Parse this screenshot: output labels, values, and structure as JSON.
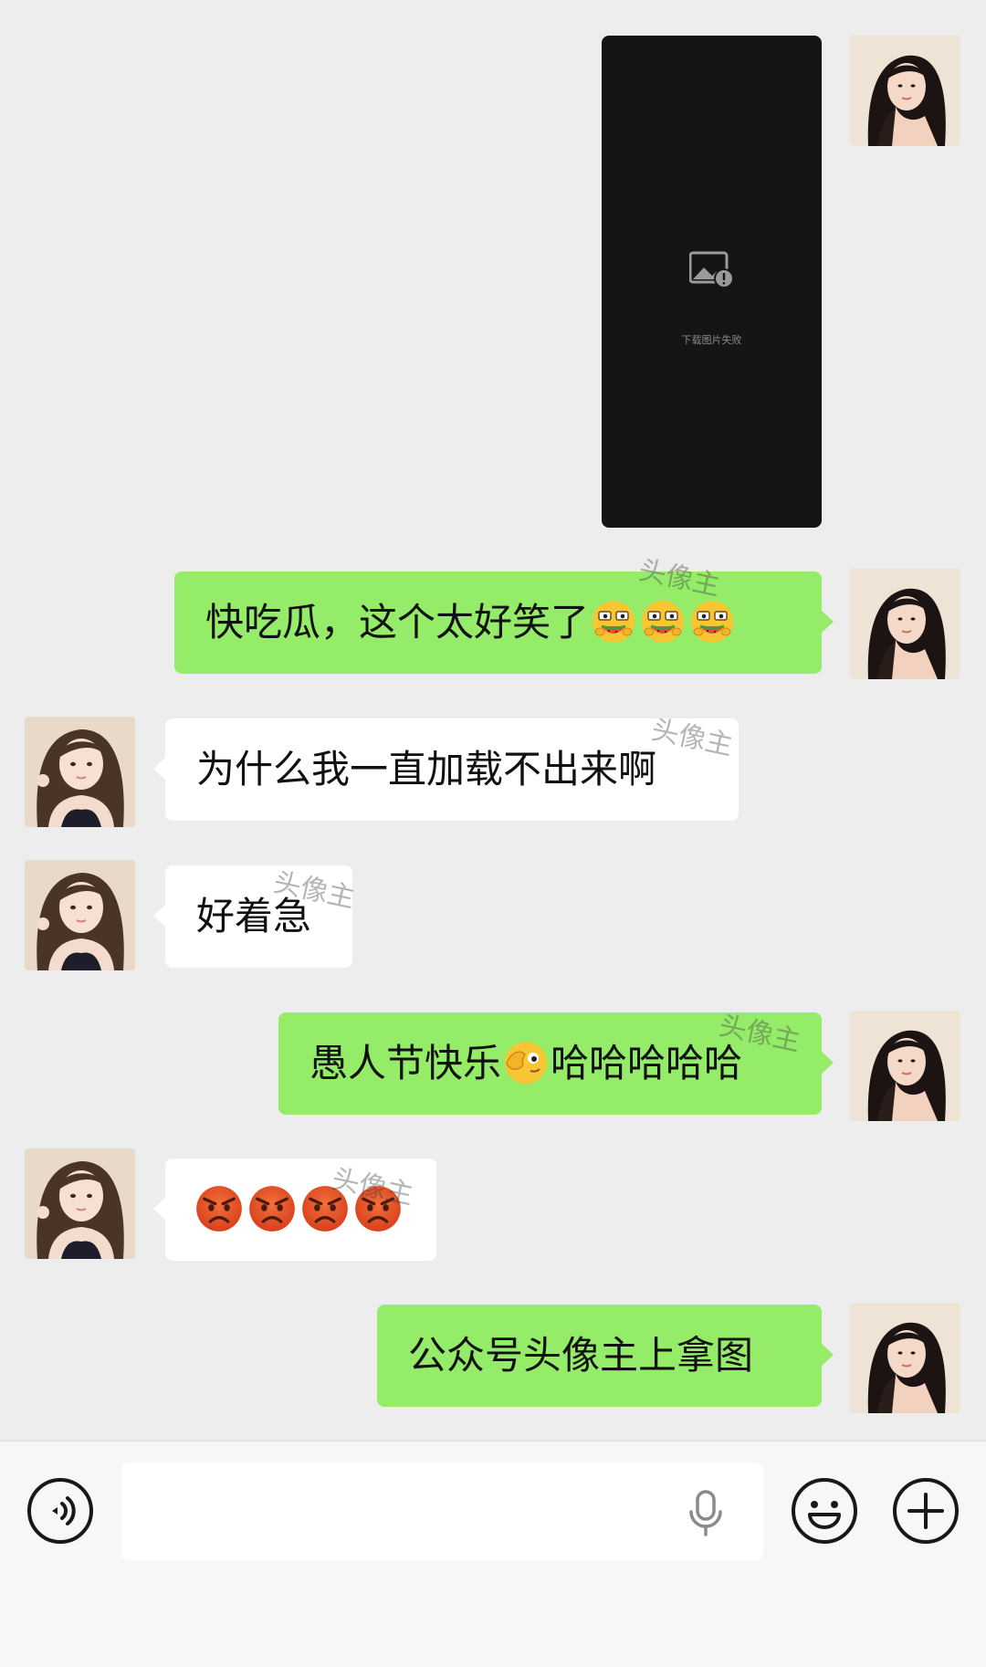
{
  "image_message": {
    "status_text": "下载图片失败",
    "icon": "image-broken-icon"
  },
  "messages": [
    {
      "side": "me",
      "text": "快吃瓜，这个太好笑了",
      "emojis": [
        "melon-eating-emoji",
        "melon-eating-emoji",
        "melon-eating-emoji"
      ]
    },
    {
      "side": "them",
      "text": "为什么我一直加载不出来啊"
    },
    {
      "side": "them",
      "text": "好着急"
    },
    {
      "side": "me",
      "text_before": "愚人节快乐",
      "emoji": "facepalm-peek-emoji",
      "text_after": "哈哈哈哈哈"
    },
    {
      "side": "them",
      "emojis": [
        "angry-face-emoji",
        "angry-face-emoji",
        "angry-face-emoji",
        "angry-face-emoji"
      ]
    },
    {
      "side": "me",
      "text": "公众号头像主上拿图"
    }
  ],
  "watermark": "头像主",
  "input_bar": {
    "voice_button_icon": "voice-mode-icon",
    "input_value": "",
    "mic_icon": "microphone-icon",
    "emoji_button_icon": "emoji-icon",
    "more_button_icon": "plus-icon"
  },
  "colors": {
    "background": "#ededed",
    "my_bubble": "#95ec69",
    "their_bubble": "#ffffff",
    "image_placeholder": "#151515"
  }
}
